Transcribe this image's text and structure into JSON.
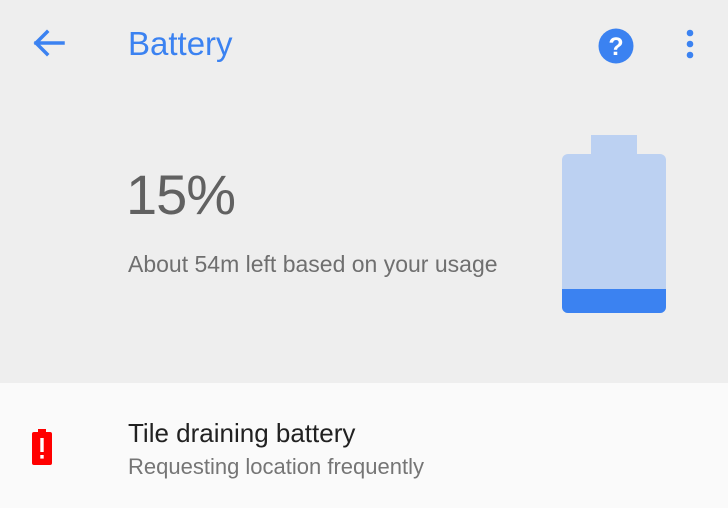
{
  "toolbar": {
    "title": "Battery",
    "back_icon": "arrow-back-icon",
    "help_icon": "help-circle-icon",
    "more_icon": "more-vert-icon",
    "accent_color": "#3b82f1"
  },
  "battery": {
    "percent_label": "15%",
    "level": 0.15,
    "estimate": "About 54m left based on your usage",
    "fill_color": "#3b82f1",
    "empty_color": "#bcd1f2"
  },
  "tips": [
    {
      "title": "Tile draining battery",
      "subtitle": "Requesting location frequently",
      "icon": "battery-alert-icon",
      "icon_color": "#ff0000"
    }
  ]
}
